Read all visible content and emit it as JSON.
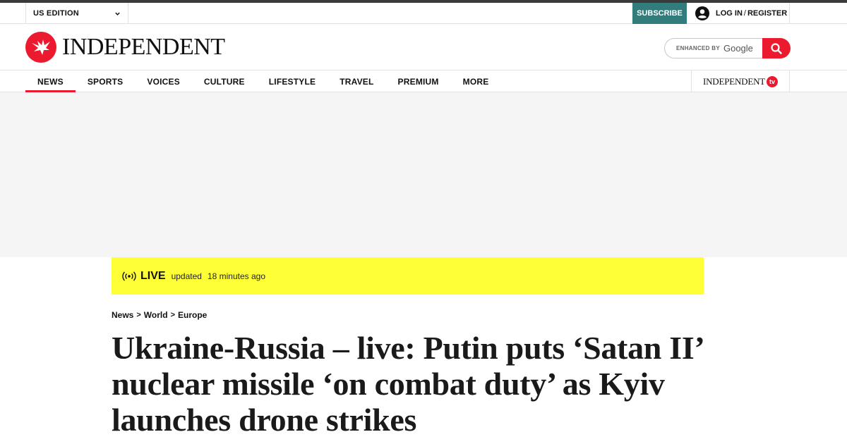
{
  "utility": {
    "edition_label": "US EDITION",
    "subscribe_label": "SUBSCRIBE",
    "login_label": "LOG IN",
    "login_sep": "/",
    "register_label": "REGISTER"
  },
  "masthead": {
    "wordmark": "INDEPENDENT",
    "logo_icon": "eagle-logo-icon",
    "search": {
      "enhanced_label": "ENHANCED BY",
      "google_label": "Google",
      "button_icon": "search-icon"
    }
  },
  "nav": {
    "items": [
      {
        "label": "NEWS",
        "active": true
      },
      {
        "label": "SPORTS"
      },
      {
        "label": "VOICES"
      },
      {
        "label": "CULTURE"
      },
      {
        "label": "LIFESTYLE"
      },
      {
        "label": "TRAVEL"
      },
      {
        "label": "PREMIUM"
      },
      {
        "label": "MORE"
      }
    ],
    "tv": {
      "word": "INDEPENDENT",
      "badge": "tv"
    }
  },
  "live": {
    "label": "LIVE",
    "updated_label": "updated",
    "time_ago": "18 minutes ago",
    "icon": "broadcast-icon"
  },
  "breadcrumb": {
    "items": [
      "News",
      "World",
      "Europe"
    ],
    "separator": ">"
  },
  "article": {
    "headline": "Ukraine-Russia – live: Putin puts ‘Satan II’ nuclear missile ‘on combat duty’ as Kyiv launches drone strikes"
  },
  "colors": {
    "brand_red": "#ec1a2e",
    "subscribe_teal": "#327c7c",
    "live_yellow": "#ffff38",
    "ad_gray": "#f5f5f5"
  }
}
